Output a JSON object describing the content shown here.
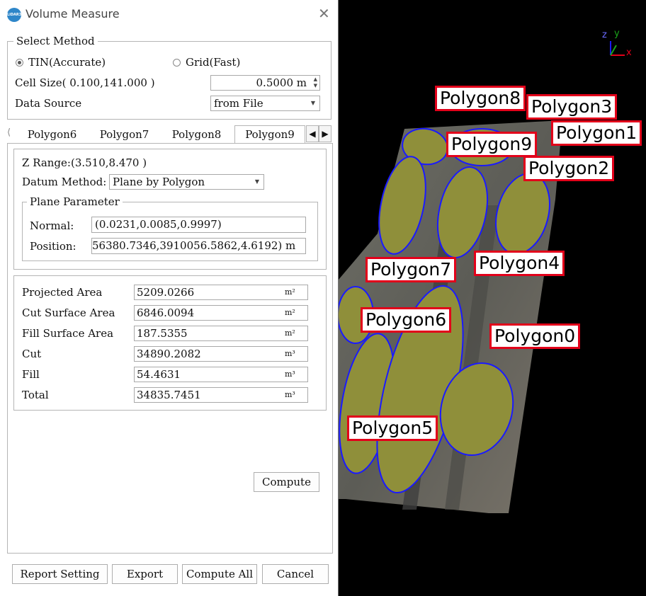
{
  "window": {
    "title": "Volume Measure",
    "icon": "LiDAR360"
  },
  "select_method": {
    "legend": "Select Method",
    "tin_label": "TIN(Accurate)",
    "grid_label": "Grid(Fast)",
    "selected": "TIN(Accurate)",
    "cell_size_label": "Cell Size( 0.100,141.000 )",
    "cell_size_value": "0.5000 m",
    "data_source_label": "Data Source",
    "data_source_value": "from File"
  },
  "tabs": [
    "Polygon6",
    "Polygon7",
    "Polygon8",
    "Polygon9"
  ],
  "active_tab": "Polygon9",
  "tab_panel": {
    "z_range": "Z Range:(3.510,8.470 )",
    "datum_label": "Datum Method:",
    "datum_value": "Plane by Polygon",
    "plane_legend": "Plane Parameter",
    "normal_label": "Normal:",
    "normal_value": "(0.0231,0.0085,0.9997)",
    "position_label": "Position:",
    "position_value": "56380.7346,3910056.5862,4.6192) m"
  },
  "results": [
    {
      "label": "Projected Area",
      "value": "5209.0266",
      "unit": "m²"
    },
    {
      "label": "Cut Surface Area",
      "value": "6846.0094",
      "unit": "m²"
    },
    {
      "label": "Fill Surface Area",
      "value": "187.5355",
      "unit": "m²"
    },
    {
      "label": "Cut",
      "value": "34890.2082",
      "unit": "m³"
    },
    {
      "label": "Fill",
      "value": "54.4631",
      "unit": "m³"
    },
    {
      "label": "Total",
      "value": "34835.7451",
      "unit": "m³"
    }
  ],
  "buttons": {
    "compute": "Compute",
    "report_setting": "Report Setting",
    "export": "Export",
    "compute_all": "Compute All",
    "cancel": "Cancel"
  },
  "viewport": {
    "axes": {
      "z": "z",
      "y": "y",
      "x": "x"
    },
    "polygon_labels": [
      "Polygon8",
      "Polygon3",
      "Polygon1",
      "Polygon9",
      "Polygon2",
      "Polygon7",
      "Polygon4",
      "Polygon6",
      "Polygon0",
      "Polygon5"
    ],
    "colors": {
      "label_border": "#e2001a",
      "polygon_outline": "#1a1aff",
      "pile_fill": "#8f8f3a"
    }
  }
}
